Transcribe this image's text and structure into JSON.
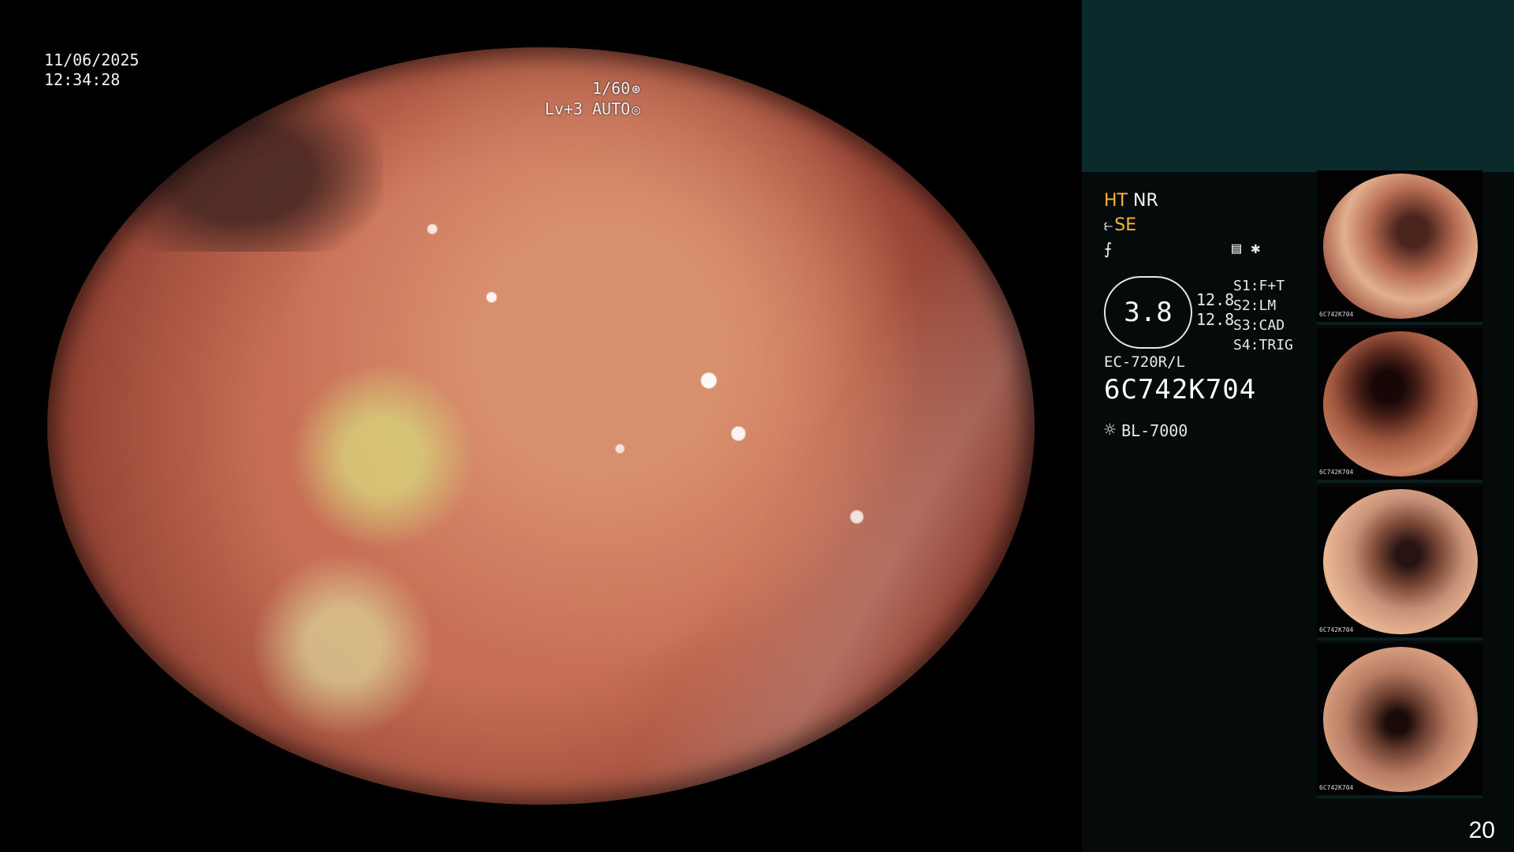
{
  "overlay": {
    "date": "11/06/2025",
    "time": "12:34:28",
    "shutter": "1/60",
    "level": "Lv+3 AUTO"
  },
  "status": {
    "ht": "HT",
    "nr": "NR",
    "se": "SE",
    "gauge_value": "3.8",
    "gauge_top": "12.8",
    "gauge_bottom": "12.8",
    "s1_label": "S1:",
    "s1_value": "F+T",
    "s2_label": "S2:",
    "s2_value": "LM",
    "s3_label": "S3:",
    "s3_value": "CAD",
    "s4_label": "S4:",
    "s4_value": "TRIG",
    "scope_model": "EC-720R/L",
    "serial": "6C742K704",
    "light_source": "BL-7000"
  },
  "thumbnails": [
    {
      "label": "6C742K704"
    },
    {
      "label": "6C742K704"
    },
    {
      "label": "6C742K704"
    },
    {
      "label": "6C742K704"
    }
  ],
  "page_number": "20",
  "icons": {
    "shutter": "⊛",
    "level": "◎",
    "scope": "⥼",
    "stylus": "⨍",
    "set": "▤",
    "light": "☼"
  }
}
